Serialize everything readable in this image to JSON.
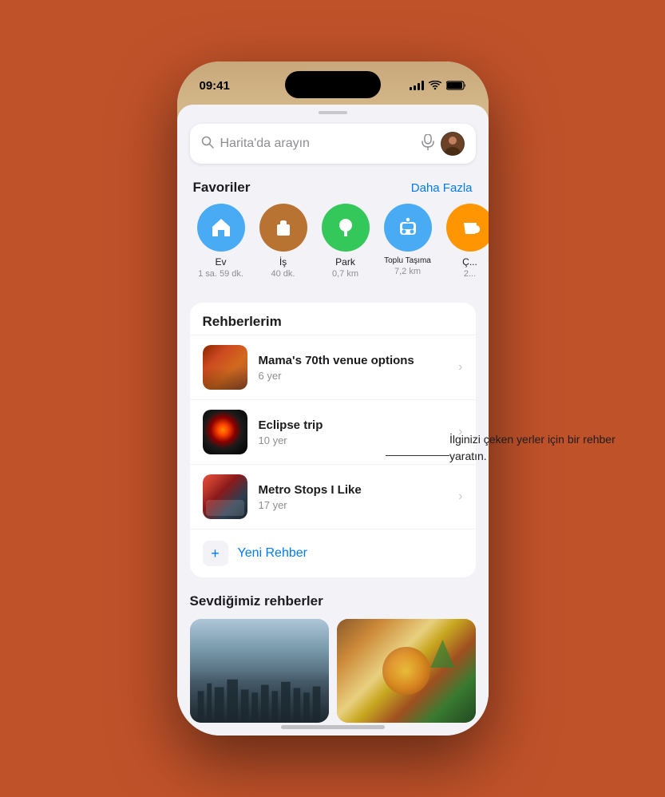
{
  "status_bar": {
    "time": "09:41",
    "signal": "●●●●",
    "wifi": "wifi",
    "battery": "battery"
  },
  "search": {
    "placeholder": "Harita'da arayın"
  },
  "favorites": {
    "section_title": "Favoriler",
    "more_label": "Daha Fazla",
    "items": [
      {
        "id": "ev",
        "name": "Ev",
        "detail": "1 sa. 59 dk.",
        "color": "#4aabf5",
        "icon": "🏠"
      },
      {
        "id": "is",
        "name": "İş",
        "detail": "40 dk.",
        "color": "#b87333",
        "icon": "💼"
      },
      {
        "id": "park",
        "name": "Park",
        "detail": "0,7 km",
        "color": "#34c759",
        "icon": "🌳"
      },
      {
        "id": "toplu",
        "name": "Toplu Taşıma",
        "detail": "7,2 km",
        "color": "#4aabf5",
        "icon": "🚇"
      },
      {
        "id": "ca",
        "name": "Ç...",
        "detail": "2...",
        "color": "#ff9500",
        "icon": "☕"
      }
    ]
  },
  "guides": {
    "section_title": "Rehberlerim",
    "items": [
      {
        "id": "mamas",
        "name": "Mama's 70th venue options",
        "count": "6 yer"
      },
      {
        "id": "eclipse",
        "name": "Eclipse trip",
        "count": "10 yer"
      },
      {
        "id": "metro",
        "name": "Metro Stops I Like",
        "count": "17 yer"
      }
    ],
    "new_guide_label": "Yeni Rehber",
    "new_guide_icon": "+"
  },
  "annotation": {
    "text": "İlginizi çeken yerler için\nbir rehber yaratın."
  },
  "loved_guides": {
    "section_title": "Sevdiğimiz rehberler"
  }
}
